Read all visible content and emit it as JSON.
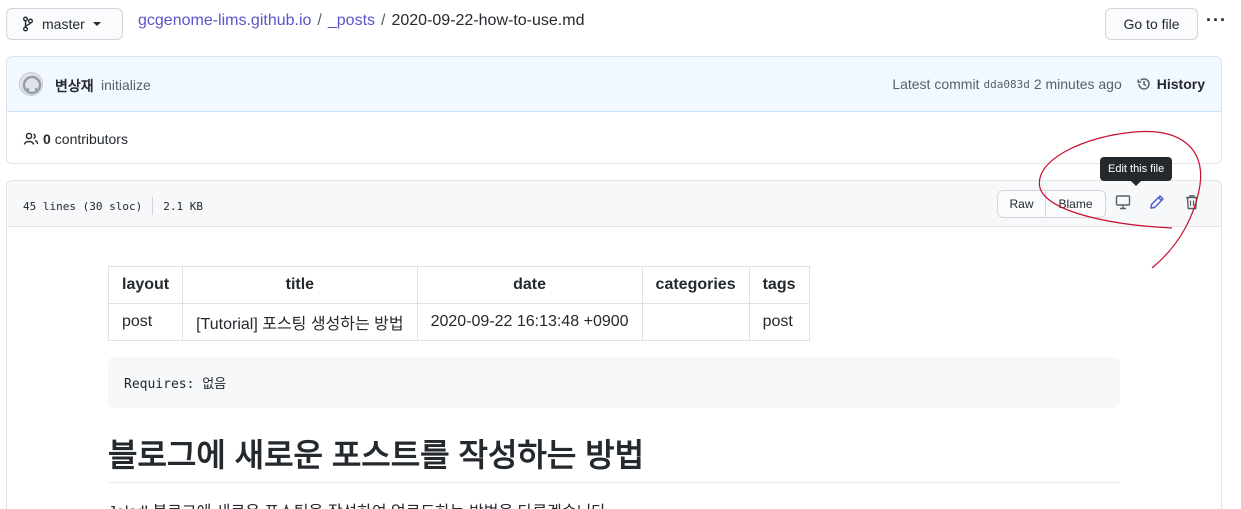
{
  "branch": {
    "label": "master",
    "icon": "git-branch-icon"
  },
  "breadcrumb": {
    "repo": "gcgenome-lims.github.io",
    "sep1": "/",
    "folder": "_posts",
    "sep2": "/",
    "file": "2020-09-22-how-to-use.md"
  },
  "goto_file": "Go to file",
  "more_menu": "···",
  "commit": {
    "author": "변상재",
    "message": "initialize",
    "latest_label": "Latest commit",
    "sha": "dda083d",
    "time": "2 minutes ago",
    "history_label": "History"
  },
  "contributors": {
    "count": "0",
    "label": "contributors"
  },
  "file_header": {
    "lines": "45 lines (30 sloc)",
    "size": "2.1 KB",
    "raw_label": "Raw",
    "blame_label": "Blame",
    "tooltip": "Edit this file"
  },
  "front_matter": {
    "headers": [
      "layout",
      "title",
      "date",
      "categories",
      "tags"
    ],
    "row": [
      "post",
      "[Tutorial] 포스팅 생성하는 방법",
      "2020-09-22 16:13:48 +0900",
      "",
      "post"
    ]
  },
  "code_block": "Requires: 없음",
  "heading": "블로그에 새로운 포스트를 작성하는 방법",
  "paragraph": "Jekyll 블로그에 새로운 포스팅을 작성하여 업로드하는 방법을 다루겠습니다.",
  "colors": {
    "link": "#5a55c9",
    "annotation": "#c8102e",
    "commit_bg": "#f1f8ff"
  }
}
